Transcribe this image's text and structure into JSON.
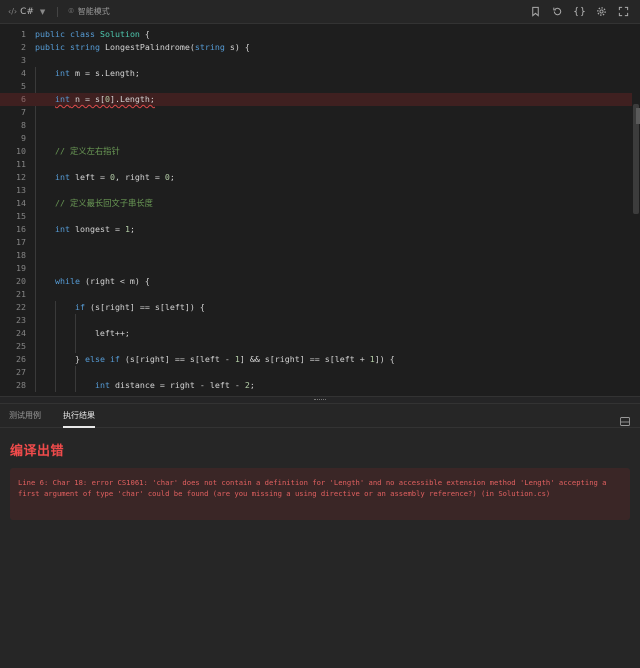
{
  "toolbar": {
    "language": "C#",
    "mode_label": "智能模式",
    "icons": [
      "bookmark-icon",
      "reset-icon",
      "braces-icon",
      "settings-icon",
      "expand-icon"
    ]
  },
  "editor": {
    "line_numbers": [
      "1",
      "2",
      "3",
      "4",
      "5",
      "6",
      "7",
      "8",
      "9",
      "10",
      "11",
      "12",
      "13",
      "14",
      "15",
      "16",
      "17",
      "18",
      "19",
      "20",
      "21",
      "22",
      "23",
      "24",
      "25",
      "26",
      "27",
      "28"
    ],
    "error_line": 6
  },
  "panel": {
    "tabs": [
      {
        "label": "测试用例",
        "active": false
      },
      {
        "label": "执行结果",
        "active": true
      }
    ],
    "result_title": "编译出错",
    "error_message": "Line 6: Char 18: error CS1061: 'char' does not contain a definition for 'Length' and no accessible extension method 'Length' accepting a first argument of type 'char' could be found (are you missing a using directive or an assembly reference?) (in Solution.cs)"
  },
  "colors": {
    "error_red": "#f04b4b",
    "keyword": "#569cd6",
    "type": "#4ec9b0",
    "comment": "#6a9955"
  }
}
